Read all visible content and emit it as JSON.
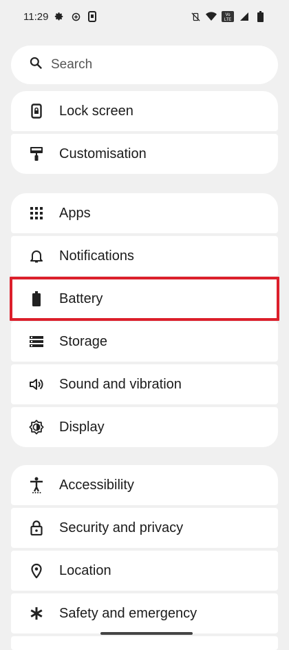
{
  "status_bar": {
    "time": "11:29",
    "left_icons": [
      "gear-icon",
      "data-saver-icon",
      "screenshot-icon"
    ],
    "right_icons": [
      "vibrate-off-icon",
      "wifi-icon",
      "volte-icon",
      "signal-icon",
      "battery-icon"
    ],
    "volte_text": "Vo LTE"
  },
  "search": {
    "placeholder": "Search"
  },
  "groups": [
    {
      "items": [
        {
          "label": "Lock screen",
          "icon": "lock-screen-icon"
        },
        {
          "label": "Customisation",
          "icon": "paint-roller-icon"
        }
      ]
    },
    {
      "items": [
        {
          "label": "Apps",
          "icon": "apps-grid-icon"
        },
        {
          "label": "Notifications",
          "icon": "bell-icon"
        },
        {
          "label": "Battery",
          "icon": "battery-icon",
          "highlighted": true
        },
        {
          "label": "Storage",
          "icon": "storage-icon"
        },
        {
          "label": "Sound and vibration",
          "icon": "speaker-icon"
        },
        {
          "label": "Display",
          "icon": "brightness-icon"
        }
      ]
    },
    {
      "items": [
        {
          "label": "Accessibility",
          "icon": "accessibility-icon"
        },
        {
          "label": "Security and privacy",
          "icon": "padlock-icon"
        },
        {
          "label": "Location",
          "icon": "location-pin-icon"
        },
        {
          "label": "Safety and emergency",
          "icon": "asterisk-icon"
        }
      ]
    }
  ],
  "colors": {
    "background": "#f0f0f0",
    "card": "#ffffff",
    "highlight_border": "#dc1f2b"
  }
}
